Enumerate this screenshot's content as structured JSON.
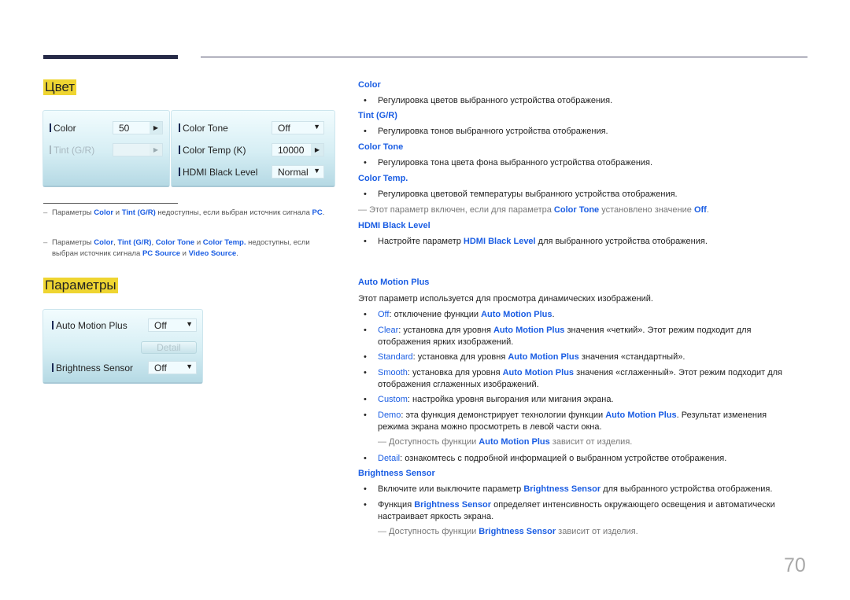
{
  "page_number": "70",
  "left": {
    "color_section": {
      "title": "Цвет",
      "panel_left": [
        {
          "label": "Color",
          "value": "50",
          "control": "arrow",
          "disabled": false
        },
        {
          "label": "Tint (G/R)",
          "value": "",
          "control": "arrow",
          "disabled": true
        }
      ],
      "panel_right": [
        {
          "label": "Color Tone",
          "value": "Off",
          "control": "dropdown"
        },
        {
          "label": "Color Temp (K)",
          "value": "10000",
          "control": "arrow"
        },
        {
          "label": "HDMI Black Level",
          "value": "Normal",
          "control": "dropdown"
        }
      ],
      "notes": [
        {
          "parts": [
            "Параметры ",
            "Color",
            " и ",
            "Tint (G/R)",
            " недоступны, если выбран источник сигнала ",
            "PC",
            "."
          ]
        },
        {
          "parts": [
            "Параметры ",
            "Color",
            ", ",
            "Tint (G/R)",
            ", ",
            "Color Tone",
            " и ",
            "Color Temp.",
            " недоступны, если выбран источник сигнала ",
            "PC Source",
            " и ",
            "Video Source",
            "."
          ]
        }
      ]
    },
    "params_section": {
      "title": "Параметры",
      "rows": [
        {
          "label": "Auto Motion Plus",
          "value": "Off",
          "control": "dropdown"
        },
        {
          "label": "Brightness Sensor",
          "value": "Off",
          "control": "dropdown"
        }
      ],
      "detail_button": "Detail"
    }
  },
  "right": {
    "color": {
      "heading": "Color",
      "bullet": "Регулировка цветов выбранного устройства отображения."
    },
    "tint": {
      "heading": "Tint (G/R)",
      "bullet": "Регулировка тонов выбранного устройства отображения."
    },
    "color_tone": {
      "heading": "Color Tone",
      "bullet": "Регулировка тона цвета фона выбранного устройства отображения."
    },
    "color_temp": {
      "heading": "Color Temp.",
      "bullet": "Регулировка цветовой температуры выбранного устройства отображения.",
      "note": [
        "Этот параметр включен, если для параметра ",
        "Color Tone",
        " установлено значение ",
        "Off",
        "."
      ]
    },
    "hdmi": {
      "heading": "HDMI Black Level",
      "bullet": [
        "Настройте параметр ",
        "HDMI Black Level",
        " для выбранного устройства отображения."
      ]
    },
    "amp": {
      "heading": "Auto Motion Plus",
      "intro": "Этот параметр используется для просмотра динамических изображений.",
      "items": [
        {
          "term": "Off",
          "lines": [
            [
              ": отключение функции ",
              "Auto Motion Plus",
              "."
            ]
          ]
        },
        {
          "term": "Clear",
          "lines": [
            [
              ": установка для уровня ",
              "Auto Motion Plus",
              " значения «четкий». Этот режим подходит для"
            ],
            [
              "отображения ярких изображений."
            ]
          ]
        },
        {
          "term": "Standard",
          "lines": [
            [
              ": установка для уровня ",
              "Auto Motion Plus",
              " значения «стандартный»."
            ]
          ]
        },
        {
          "term": "Smooth",
          "lines": [
            [
              ": установка для уровня ",
              "Auto Motion Plus",
              " значения «сглаженный». Этот режим подходит для"
            ],
            [
              "отображения сглаженных изображений."
            ]
          ]
        },
        {
          "term": "Custom",
          "lines": [
            [
              ": настройка уровня выгорания или мигания экрана."
            ]
          ]
        },
        {
          "term": "Demo",
          "lines": [
            [
              ": эта функция демонстрирует технологии функции ",
              "Auto Motion Plus",
              ". Результат изменения"
            ],
            [
              "режима экрана можно просмотреть в левой части окна."
            ]
          ]
        },
        {
          "term": "Detail",
          "lines": [
            [
              ": ознакомтесь с подробной информацией о выбранном устройстве отображения."
            ]
          ]
        }
      ],
      "note": [
        "Доступность функции ",
        "Auto Motion Plus",
        " зависит от изделия."
      ]
    },
    "brightness": {
      "heading": "Brightness Sensor",
      "bullet1": [
        "Включите или выключите параметр ",
        "Brightness Sensor",
        " для выбранного устройства отображения."
      ],
      "bullet2": [
        "Функция ",
        "Brightness Sensor",
        " определяет интенсивность окружающего освещения и автоматически"
      ],
      "bullet2_cont": "настраивает яркость экрана.",
      "note": [
        "Доступность функции ",
        "Brightness Sensor",
        " зависит от изделия."
      ]
    }
  },
  "colors": {
    "accent_blue": "#1a5de3",
    "title_highlight": "#efd531",
    "topbar": "#262a47"
  }
}
